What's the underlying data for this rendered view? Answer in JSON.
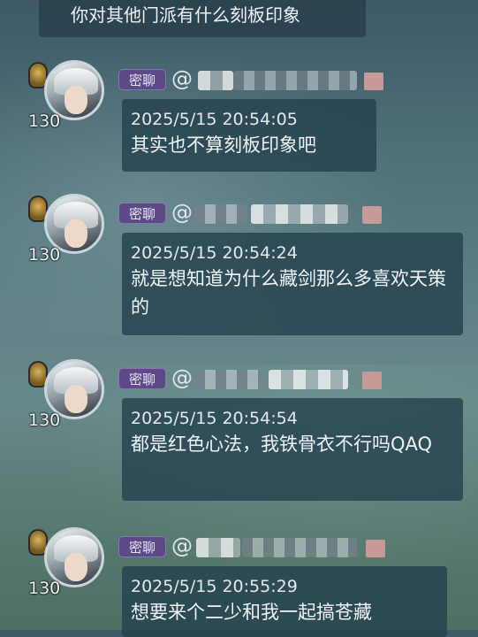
{
  "top_message": "你对其他门派有什么刻板印象",
  "messages": [
    {
      "tag": "密聊",
      "at": "@",
      "level": "130",
      "time": "2025/5/15 20:54:05",
      "text": "其实也不算刻板印象吧"
    },
    {
      "tag": "密聊",
      "at": "@",
      "level": "130",
      "time": "2025/5/15 20:54:24",
      "text": "就是想知道为什么藏剑那么多喜欢天策的"
    },
    {
      "tag": "密聊",
      "at": "@",
      "level": "130",
      "time": "2025/5/15 20:54:54",
      "text": "都是红色心法，我铁骨衣不行吗QAQ"
    },
    {
      "tag": "密聊",
      "at": "@",
      "level": "130",
      "time": "2025/5/15 20:55:29",
      "text": "想要来个二少和我一起搞苍藏"
    }
  ],
  "colors": {
    "tag_bg": "#5b4a86",
    "bubble_bg": "#25424e"
  }
}
